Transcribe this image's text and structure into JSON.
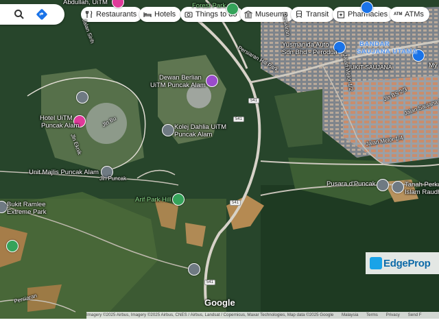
{
  "search": {
    "icon": "search-icon",
    "directions_icon": "directions-icon"
  },
  "chips": [
    {
      "label": "Restaurants",
      "icon": "fork-knife-icon"
    },
    {
      "label": "Hotels",
      "icon": "bed-icon"
    },
    {
      "label": "Things to do",
      "icon": "camera-icon"
    },
    {
      "label": "Museums",
      "icon": "museum-icon"
    },
    {
      "label": "Transit",
      "icon": "train-icon"
    },
    {
      "label": "Pharmacies",
      "icon": "pharmacy-icon"
    },
    {
      "label": "ATMs",
      "icon": "atm-icon"
    }
  ],
  "places": {
    "abdullah": "Abdullah, UiTM",
    "forest_park": "Forest Park",
    "dewan_line1": "Dewan Berlian",
    "dewan_line2": "UiTM Puncak Alam",
    "hotel_line1": "Hotel UiTM",
    "hotel_line2": "Puncak Alam",
    "kolej_line1": "Kolej Dahlia UiTM",
    "kolej_line2": "Puncak Alam",
    "unit_majlis": "Unit Majlis Puncak Alam",
    "arif_park": "Arif Park Hill",
    "bukit_ramlee_line1": "Bukit Ramlee",
    "bukit_ramlee_line2": "Extreme Park",
    "yusmanida_line1": "Yusmanida Auto",
    "yusmanida_line2": "Sdn Bhd - Perodua",
    "bandar_line1": "BANDAR",
    "bandar_line2": "SAUJANA UTAMA",
    "bukit_saujana": "BUKIT SAUJANA",
    "pusara": "Pusara d'Puncak",
    "tanah_line1": "Tanah Perku",
    "tanah_line2": "Islam Raudh",
    "my": "My"
  },
  "roads": {
    "persiaran_hill_park": "Persiaran Hill Park",
    "jalan_bs": "Jln BS 2/3",
    "jalan_saujana": "Jalan Saujana 1/",
    "jalan_melor": "Jalan Melor 1/4",
    "jalan_melor_v": "Jalan Melor 1/2",
    "jln_eknik": "Jln Eknik",
    "jln_bunga": "Jln Bu",
    "jln_puncak": "Jln Puncak",
    "jalan_sirih": "Jalan Sirih",
    "persiaran": "Persiaran",
    "persiaran_2": "Persiaran",
    "route_541_a": "541",
    "route_541_b": "541",
    "route_541_c": "541",
    "route_541_d": "541"
  },
  "branding": {
    "google": "Google",
    "edgeprop": "EdgeProp"
  },
  "attribution": {
    "imagery": "Imagery ©2025 Airbus, Imagery ©2025 Airbus, CNES / Airbus, Landsat / Copernicus, Maxar Technologies, Map data ©2025 Google",
    "country": "Malaysia",
    "terms": "Terms",
    "privacy": "Privacy",
    "send": "Send F"
  },
  "colors": {
    "forest_dark": "#1f3a24",
    "forest_mid": "#2c4d2e",
    "urban": "#8a8f96",
    "bare_soil": "#b7905a",
    "road": "#d9d6cf",
    "poi_pink": "#e0399a",
    "poi_purple": "#9a4ccc",
    "poi_green": "#35a35a",
    "poi_grey": "#6f7a83",
    "poi_blue": "#1a73e8"
  }
}
